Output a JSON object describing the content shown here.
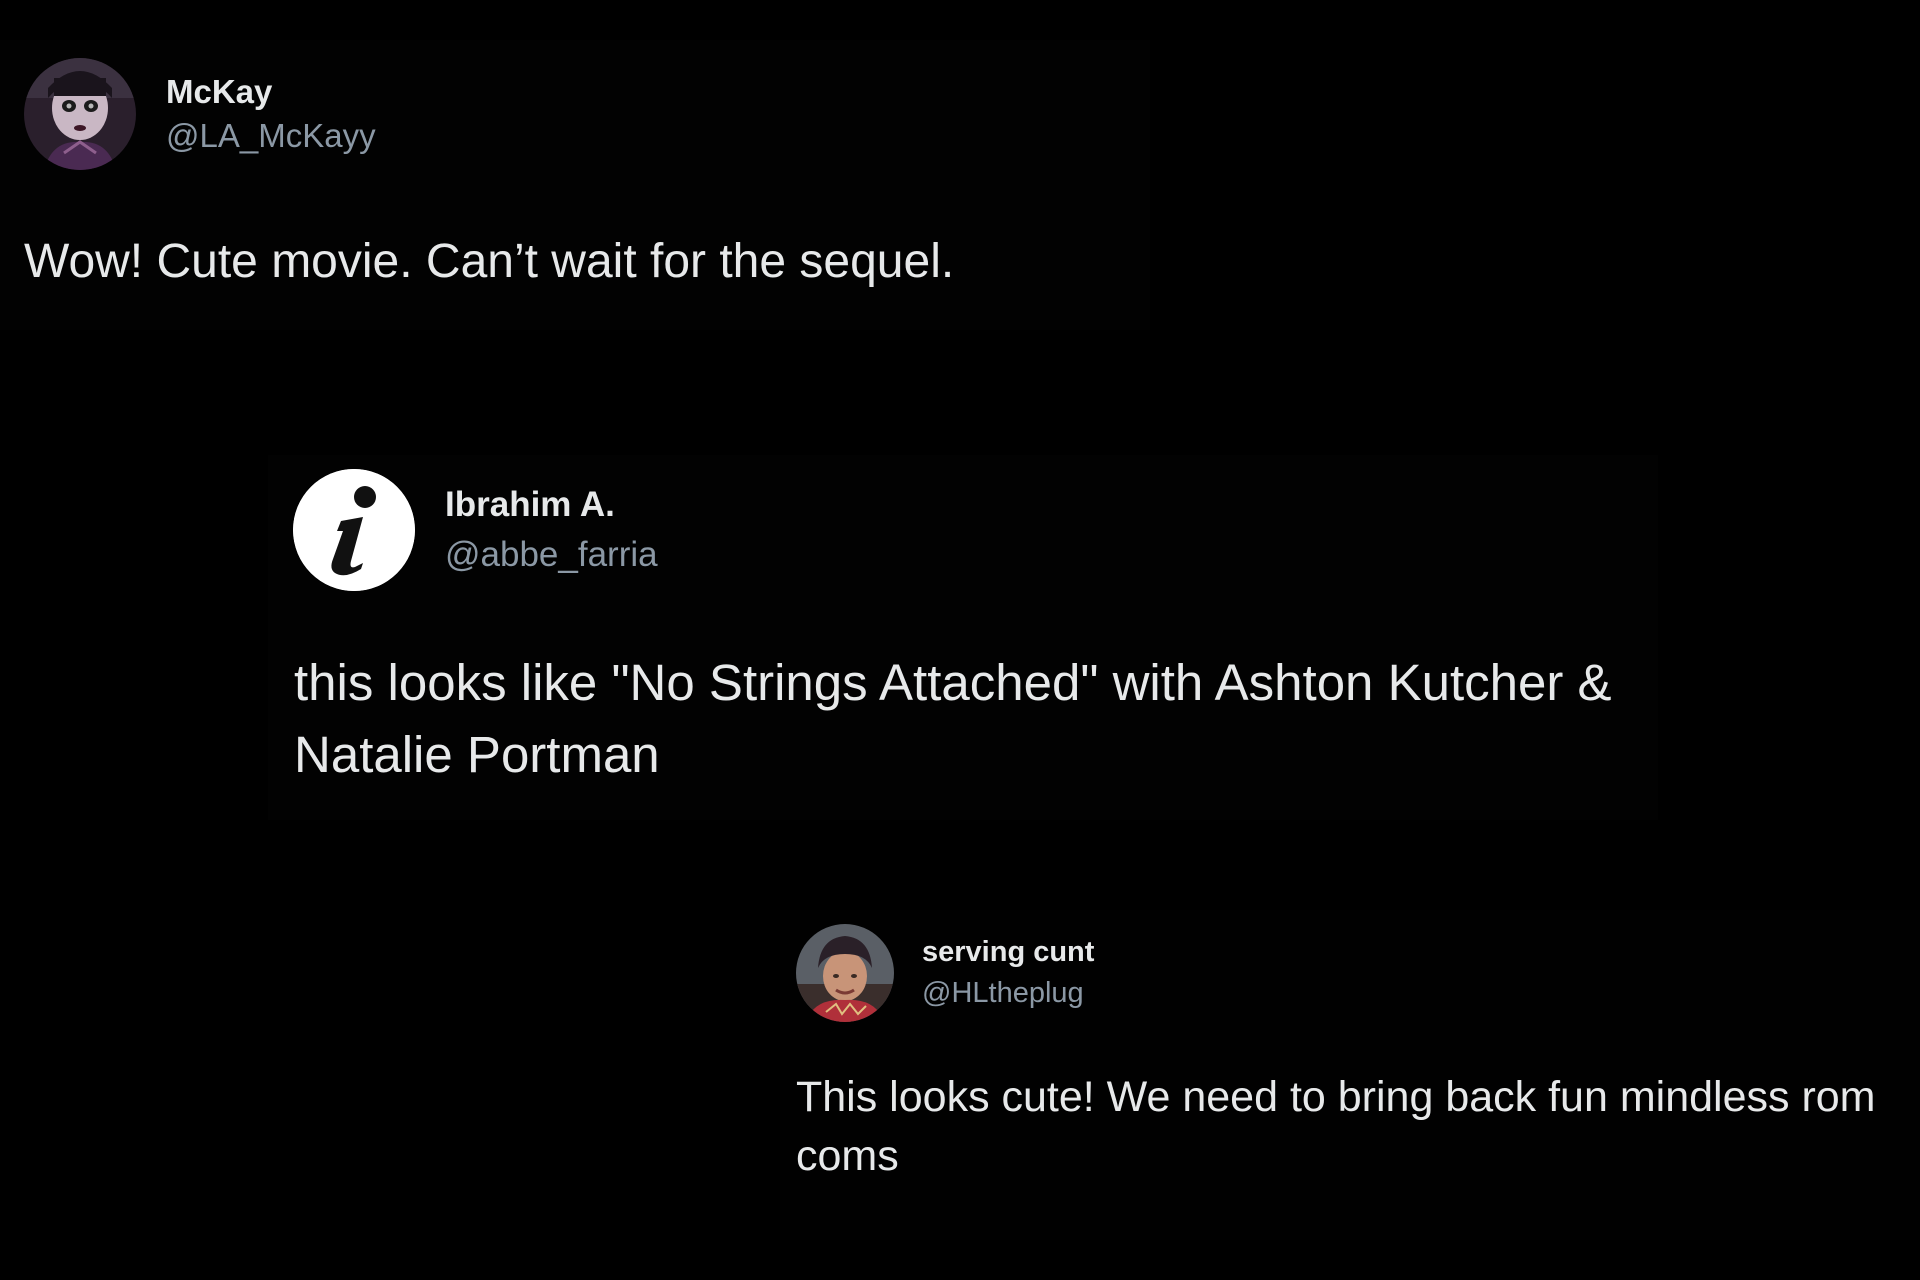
{
  "tweets": [
    {
      "display_name": "McKay",
      "handle": "@LA_McKayy",
      "text": "Wow! Cute movie. Can’t wait for the sequel.",
      "avatar_icon": "doll-portrait-avatar"
    },
    {
      "display_name": "Ibrahim A.",
      "handle": "@abbe_farria",
      "text": "this looks like \"No Strings Attached\" with Ashton Kutcher & Natalie Portman",
      "avatar_icon": "info-i-logo-avatar"
    },
    {
      "display_name": "serving cunt",
      "handle": "@HLtheplug",
      "text": "This looks cute! We need to bring back fun mindless rom coms",
      "avatar_icon": "selfie-portrait-avatar"
    }
  ],
  "colors": {
    "background": "#000000",
    "text_primary": "#e7e9ea",
    "text_secondary": "#8b98a5"
  }
}
